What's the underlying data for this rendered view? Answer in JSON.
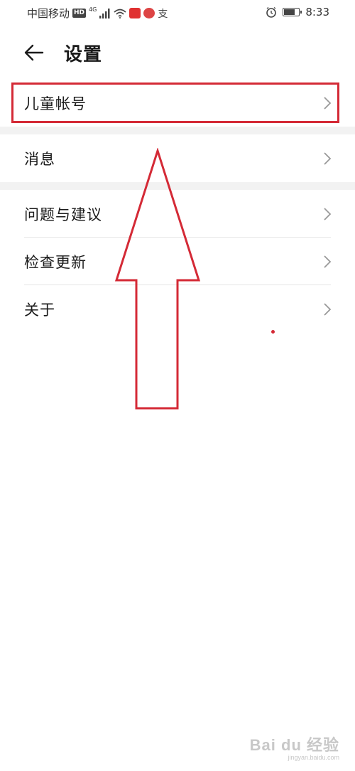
{
  "status_bar": {
    "carrier": "中国移动",
    "hd_badge": "HD",
    "network_type": "4G",
    "alipay_glyph": "支",
    "time": "8:33",
    "battery_level_percent": 75,
    "icons": [
      "signal-icon",
      "wifi-icon",
      "app-notification-icon",
      "alarm-icon",
      "battery-icon"
    ]
  },
  "header": {
    "title": "设置",
    "back_icon": "arrow-left-icon"
  },
  "settings": {
    "group1": [
      {
        "label": "儿童帐号"
      }
    ],
    "group2": [
      {
        "label": "消息"
      }
    ],
    "group3": [
      {
        "label": "问题与建议"
      },
      {
        "label": "检查更新"
      },
      {
        "label": "关于"
      }
    ]
  },
  "annotation": {
    "color": "#d42a36"
  },
  "watermark": {
    "main": "Bai du 经验",
    "sub": "jingyan.baidu.com"
  }
}
